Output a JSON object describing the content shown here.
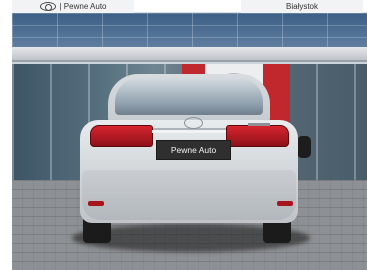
{
  "header": {
    "left_label": "| Pewne Auto",
    "right_label": "Białystok"
  },
  "photo": {
    "plate_text": "Pewne Auto",
    "accent_red": "#c1282e",
    "car_color": "#d5d9dc"
  },
  "icons": {
    "brand_logo": "toyota-logo-icon"
  }
}
